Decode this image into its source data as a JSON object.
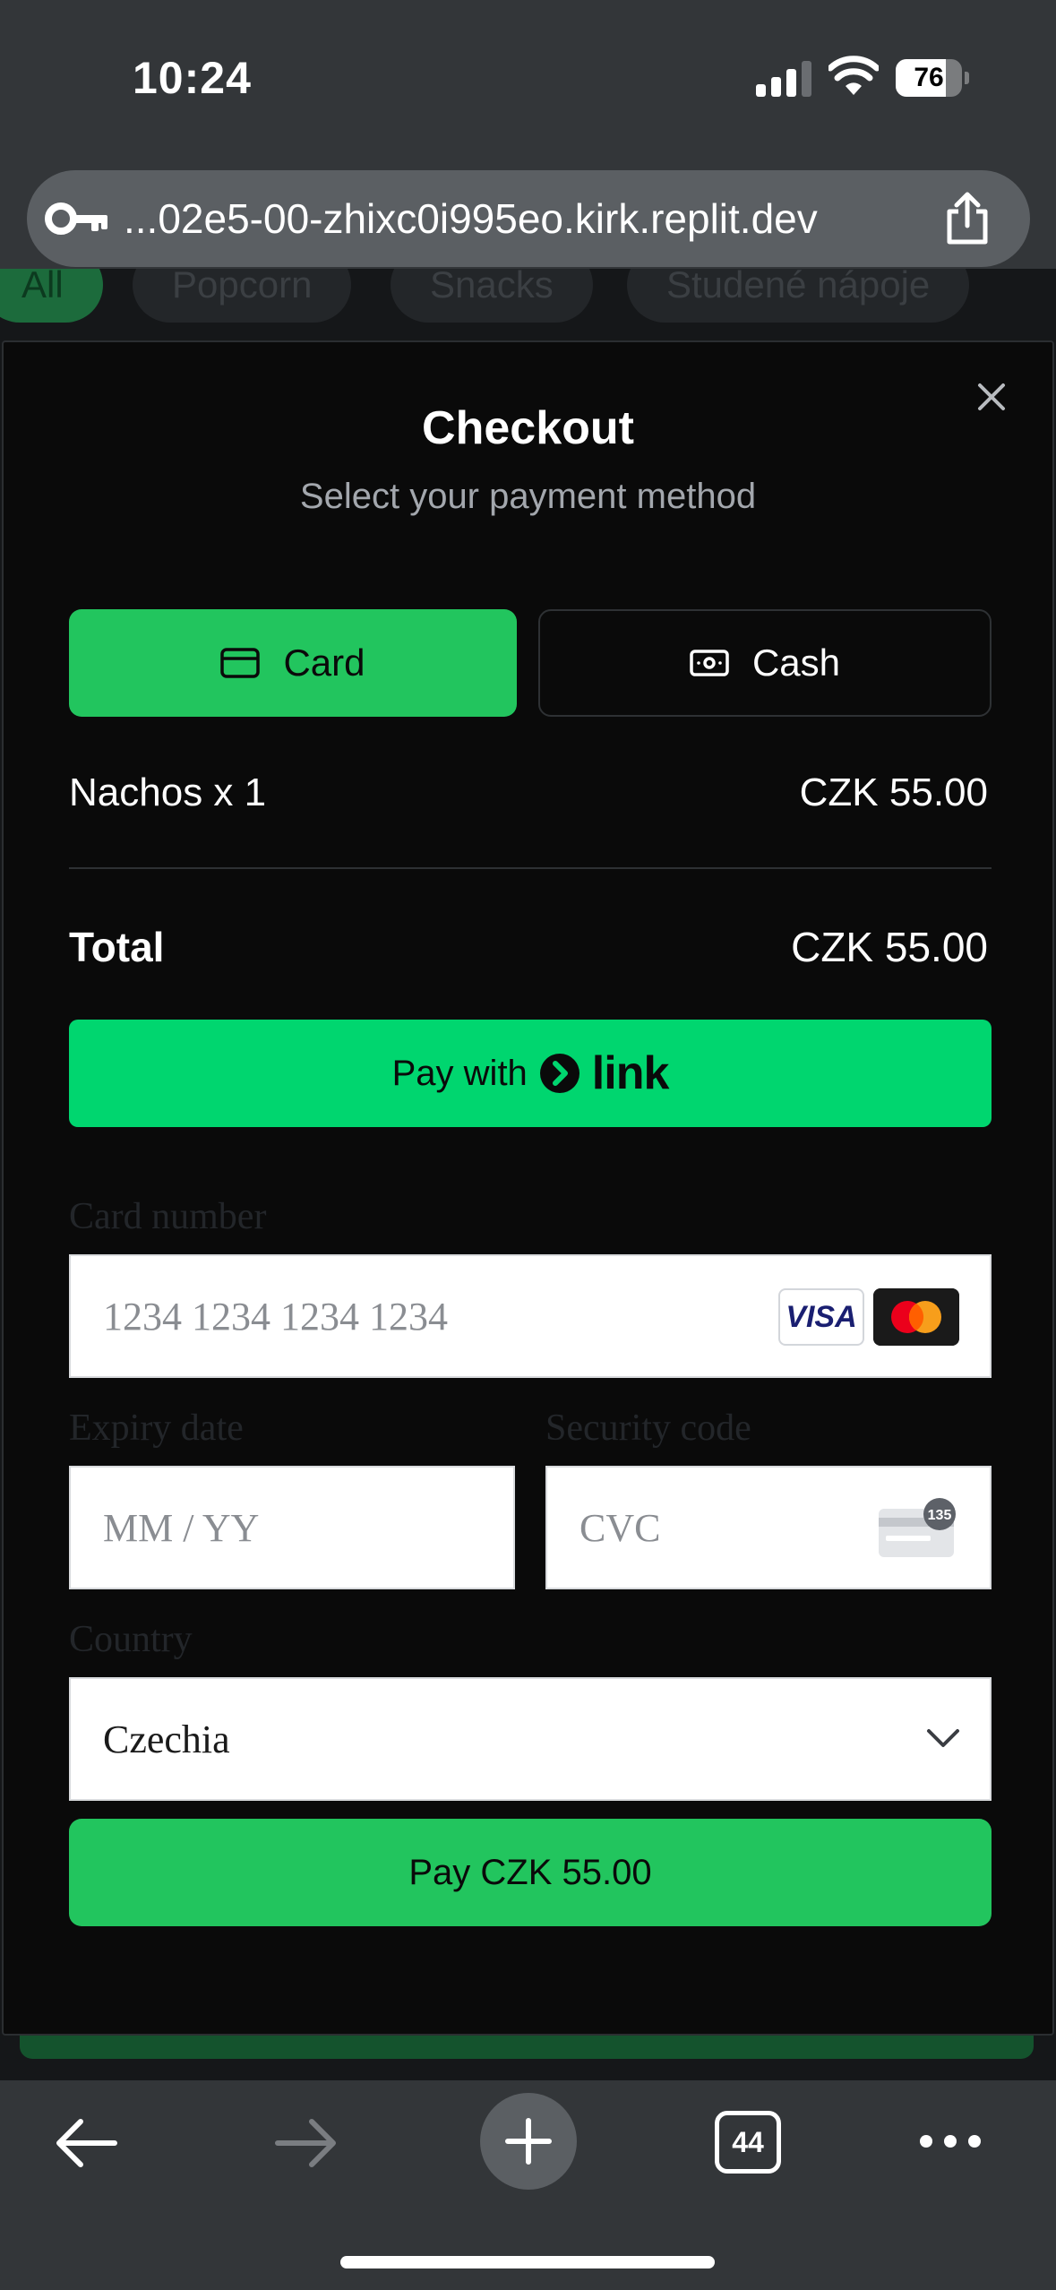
{
  "status": {
    "time": "10:24",
    "battery_level": "76",
    "battery_fraction": 0.76
  },
  "browser": {
    "url": "...02e5-00-zhixc0i995eo.kirk.replit.dev",
    "tab_count": "44"
  },
  "categories": [
    {
      "label": "All",
      "active": true
    },
    {
      "label": "Popcorn",
      "active": false
    },
    {
      "label": "Snacks",
      "active": false
    },
    {
      "label": "Studené nápoje",
      "active": false
    }
  ],
  "checkout": {
    "title": "Checkout",
    "subtitle": "Select your payment method",
    "methods": {
      "card_label": "Card",
      "cash_label": "Cash",
      "selected": "card"
    },
    "items": [
      {
        "label": "Nachos x 1",
        "price": "CZK 55.00"
      }
    ],
    "total_label": "Total",
    "total_value": "CZK 55.00",
    "link_button": {
      "prefix": "Pay with",
      "brand": "link"
    },
    "form": {
      "card_number_label": "Card number",
      "card_number_placeholder": "1234 1234 1234 1234",
      "expiry_label": "Expiry date",
      "expiry_placeholder": "MM / YY",
      "cvc_label": "Security code",
      "cvc_placeholder": "CVC",
      "cvc_badge": "135",
      "country_label": "Country",
      "country_value": "Czechia",
      "visa_text": "VISA"
    },
    "pay_button_label": "Pay CZK 55.00"
  },
  "colors": {
    "accent_green": "#22c55e",
    "link_green": "#00d66f",
    "modal_bg": "#0a0a0a",
    "chrome_bg": "#333639"
  }
}
